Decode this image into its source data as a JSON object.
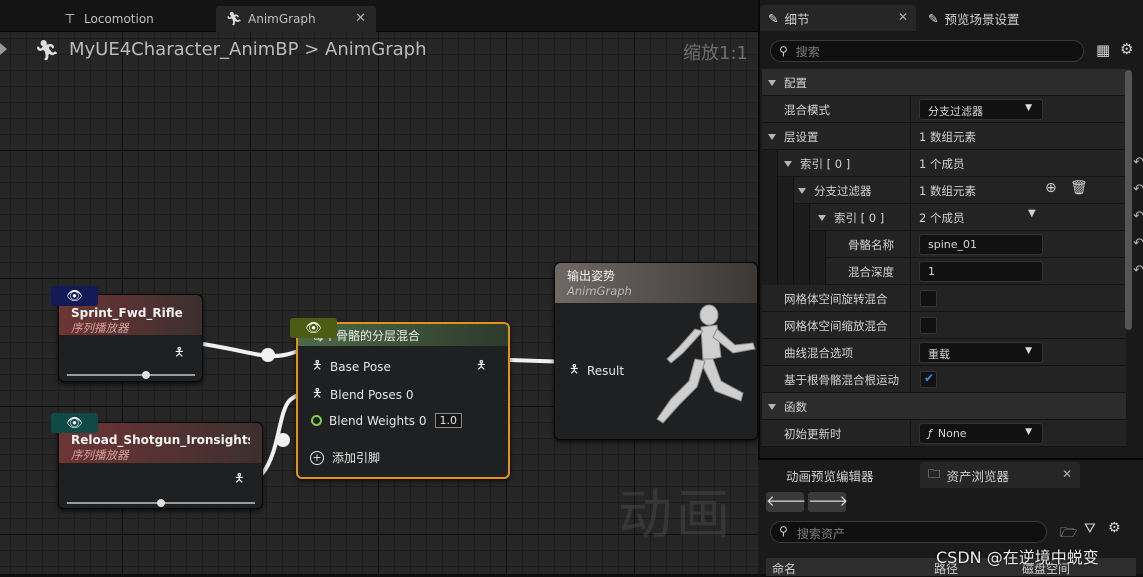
{
  "tabs": [
    {
      "label": "Locomotion",
      "icon": "state-machine-icon"
    },
    {
      "label": "AnimGraph",
      "icon": "running-man-icon"
    }
  ],
  "breadcrumb": {
    "path": "MyUE4Character_AnimBP > AnimGraph",
    "zoom": "缩放1:1"
  },
  "nodes": {
    "sprint": {
      "title": "Sprint_Fwd_Rifle",
      "subtitle": "序列播放器",
      "slider_position": 0.55
    },
    "reload": {
      "title": "Reload_Shotgun_Ironsights",
      "subtitle": "序列播放器",
      "slider_position": 0.5
    },
    "blend": {
      "title": "每个骨骼的分层混合",
      "pins": {
        "base_pose": "Base Pose",
        "blend_poses": "Blend Poses 0",
        "blend_weights": "Blend Weights 0",
        "blend_weight_value": "1.0",
        "add_pin": "添加引脚"
      }
    },
    "output": {
      "title": "输出姿势",
      "subtitle": "AnimGraph",
      "result": "Result"
    }
  },
  "watermark": "动画",
  "details": {
    "tabs": [
      "细节",
      "预览场景设置"
    ],
    "search_placeholder": "搜索",
    "rows": {
      "config": "配置",
      "blend_mode_label": "混合模式",
      "blend_mode_value": "分支过滤器",
      "layer_setup_label": "层设置",
      "layer_setup_value": "1 数组元素",
      "index0_label": "索引 [ 0 ]",
      "index0_value": "1 个成员",
      "branch_filters_label": "分支过滤器",
      "branch_filters_value": "1 数组元素",
      "index0b_label": "索引 [ 0 ]",
      "index0b_value": "2 个成员",
      "bone_name_label": "骨骼名称",
      "bone_name_value": "spine_01",
      "blend_depth_label": "混合深度",
      "blend_depth_value": "1",
      "mesh_rot_label": "网格体空间旋转混合",
      "mesh_scale_label": "网格体空间缩放混合",
      "curve_blend_label": "曲线混合选项",
      "curve_blend_value": "重载",
      "root_motion_label": "基于根骨骼混合根运动",
      "functions": "函数",
      "initial_update_label": "初始更新时",
      "initial_update_value": "None"
    },
    "mesh_rot_checked": false,
    "mesh_scale_checked": false,
    "root_motion_checked": true
  },
  "bottom": {
    "tabs": [
      "动画预览编辑器",
      "资产浏览器"
    ],
    "search_placeholder": "搜索资产",
    "columns": [
      "命名",
      "路径",
      "磁盘空间"
    ]
  },
  "overlay": "CSDN @在逆境中蜕变",
  "colors": {
    "accent": "#3b88e5",
    "selected_border": "#e3931d",
    "blend_header": "#4b6a45",
    "sequence_header": "#6e3535",
    "output_header": "#6f6865"
  }
}
